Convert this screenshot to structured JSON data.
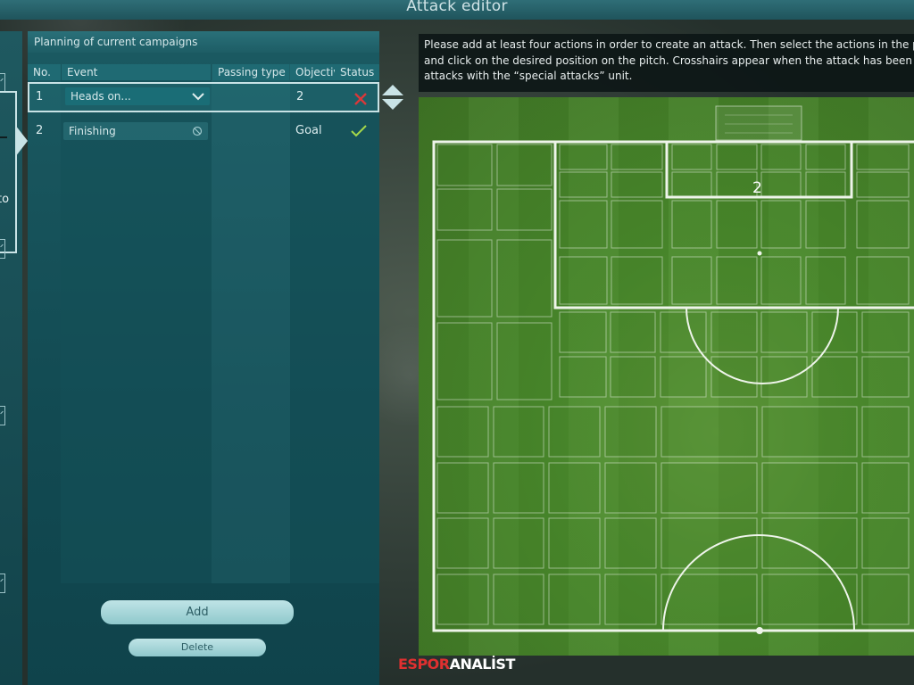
{
  "window": {
    "title": "Attack editor"
  },
  "left_panel": {
    "text": "to"
  },
  "planning": {
    "header": "Planning of current campaigns",
    "columns": [
      "No.",
      "Event",
      "Passing type",
      "Objectiv",
      "Status"
    ],
    "rows": [
      {
        "no": "1",
        "event": "Heads on...",
        "passing_type": "",
        "objective": "2",
        "status": "fail",
        "status_icon": "cross-icon"
      },
      {
        "no": "2",
        "event": "Finishing",
        "passing_type": "",
        "objective": "Goal",
        "status": "ok",
        "status_icon": "check-icon"
      }
    ],
    "add_label": "Add",
    "delete_label": "Delete"
  },
  "info_text": [
    "Please add at least four actions in order to create an attack. Then select the actions in the planning, se",
    "and click on the desired position on the pitch. Crosshairs appear when the attack has been created suc",
    "attacks with the “special attacks” unit."
  ],
  "pitch": {
    "marker_label": "2"
  },
  "watermark": {
    "part1": "ESPOR",
    "part2": "ANALİST"
  },
  "colors": {
    "panel": "#1b5a62",
    "accent": "#c9e3e6",
    "cross": "#d9383a",
    "check": "#a6d84a",
    "grass": "#4a8a2c"
  }
}
